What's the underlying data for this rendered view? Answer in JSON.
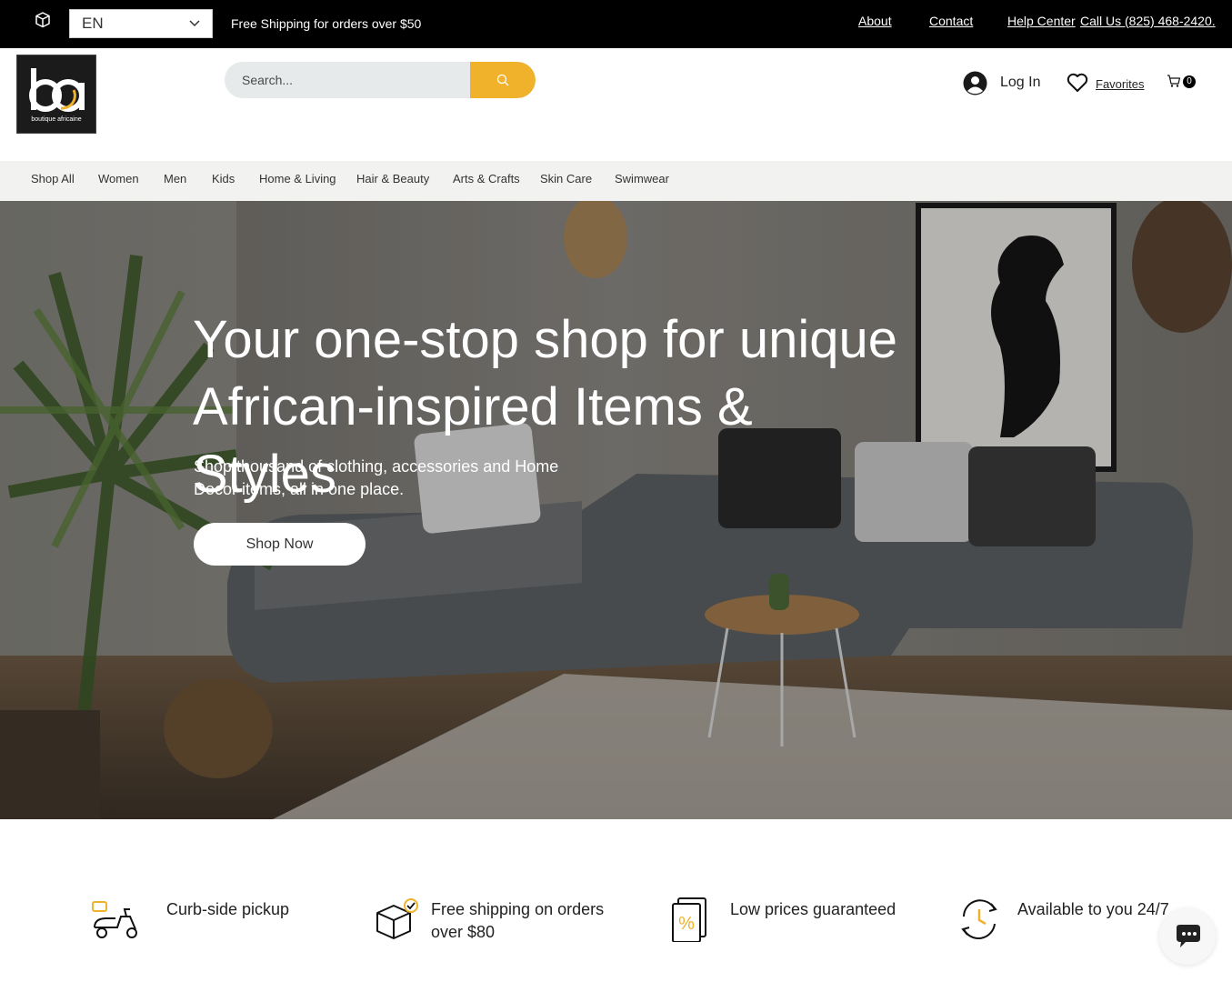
{
  "topbar": {
    "language": "EN",
    "shipping_note": "Free Shipping for orders over $50",
    "links": [
      "About",
      "Contact",
      "Help Center",
      "Call Us (825) 468-2420."
    ]
  },
  "header": {
    "logo_text": "boutique africaine",
    "search_placeholder": "Search...",
    "login_label": "Log In",
    "favorites_label": "Favorites",
    "cart_count": "0"
  },
  "nav": {
    "items": [
      "Shop All",
      "Women",
      "Men",
      "Kids",
      "Home & Living",
      "Hair & Beauty",
      "Arts & Crafts",
      "Skin Care",
      "Swimwear"
    ]
  },
  "hero": {
    "title": "Your one-stop shop for unique African-inspired Items & Styles",
    "subtitle": "Shop thousand of clothing, accessories and Home Decor items, all in one place.",
    "cta": "Shop Now"
  },
  "features": [
    {
      "text": "Curb-side pickup",
      "icon": "scooter-icon"
    },
    {
      "text": "Free shipping on orders over $80",
      "icon": "package-check-icon"
    },
    {
      "text": "Low prices guaranteed",
      "icon": "percent-tag-icon"
    },
    {
      "text": "Available to you 24/7",
      "icon": "clock-cycle-icon"
    }
  ],
  "colors": {
    "accent": "#f0b12b",
    "topbar": "#000000",
    "nav_bg": "#f2f2f1"
  }
}
